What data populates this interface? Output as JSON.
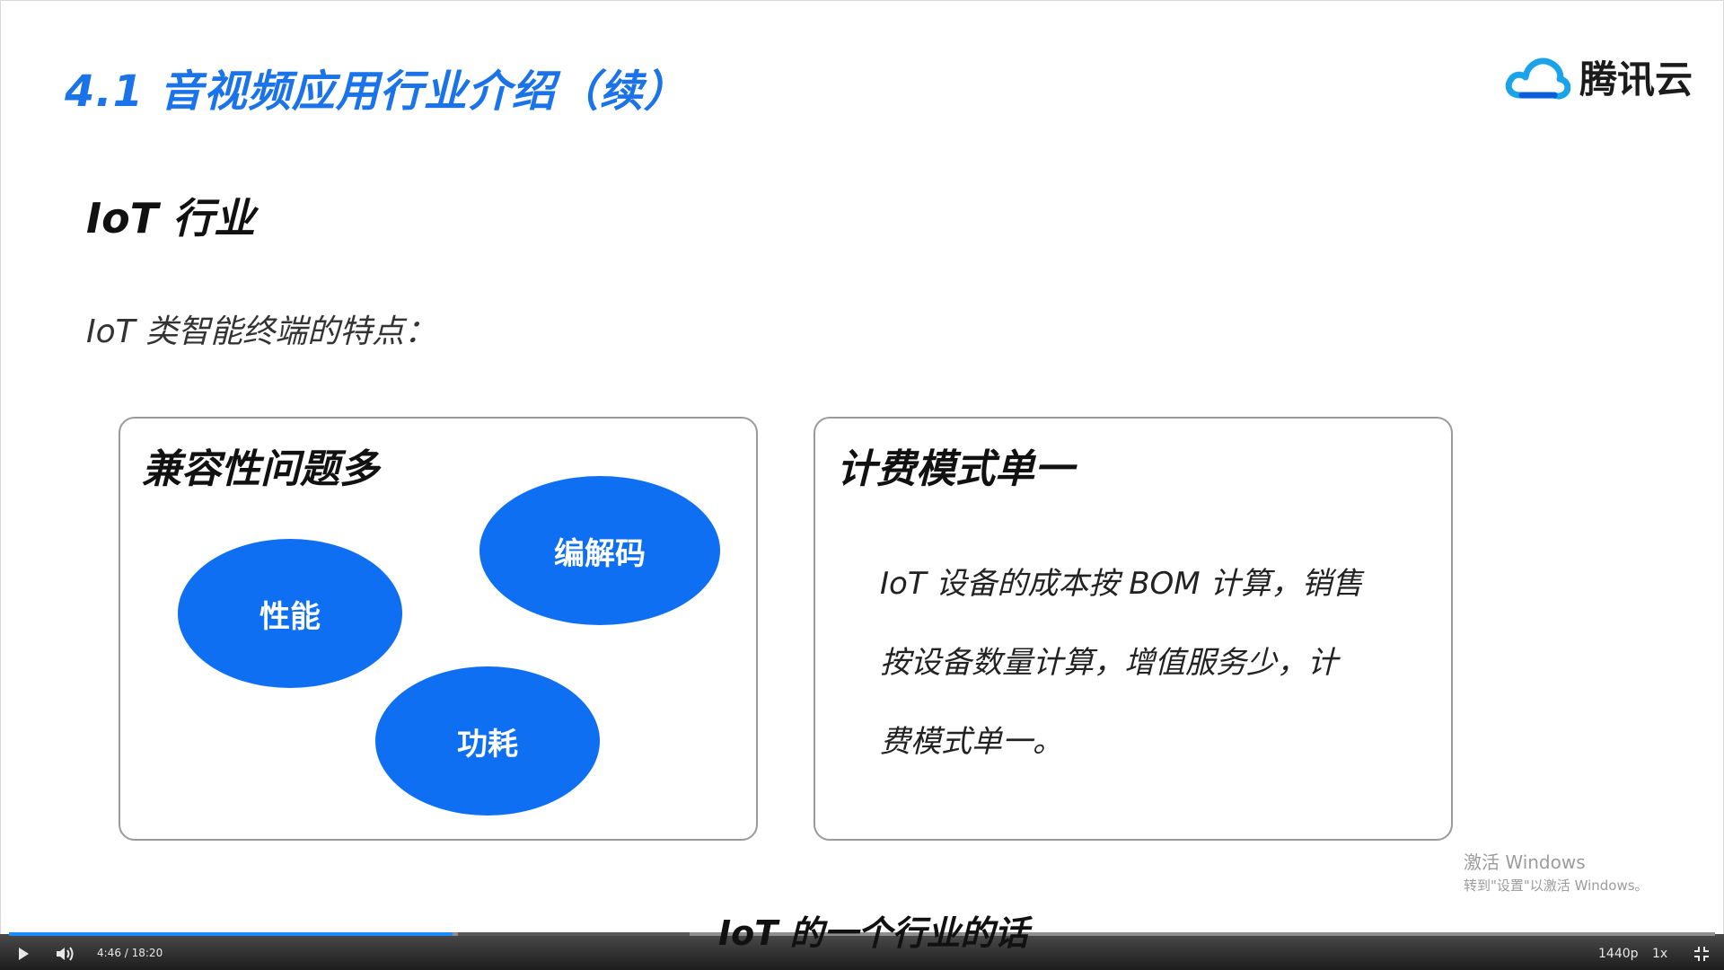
{
  "slide": {
    "title": "4.1 音视频应用行业介绍（续）",
    "logo_text": "腾讯云",
    "section_title": "IoT 行业",
    "feature_intro": "IoT 类智能终端的特点：",
    "card_left": {
      "title": "兼容性问题多",
      "bubbles": [
        "性能",
        "编解码",
        "功耗"
      ]
    },
    "card_right": {
      "title": "计费模式单一",
      "body_lines": [
        "IoT 设备的成本按 BOM 计算，销售",
        "按设备数量计算，增值服务少，计",
        "费模式单一。"
      ]
    }
  },
  "watermark": {
    "line1": "激活 Windows",
    "line2": "转到\"设置\"以激活 Windows。"
  },
  "subtitle": "IoT 的一个行业的话",
  "player": {
    "time": "4:46 / 18:20",
    "quality": "1440p",
    "speed": "1x",
    "progress": 0.26
  },
  "colors": {
    "accent": "#1a73e8",
    "bubble": "#0f6ff2",
    "progress": "#1a8cff"
  }
}
